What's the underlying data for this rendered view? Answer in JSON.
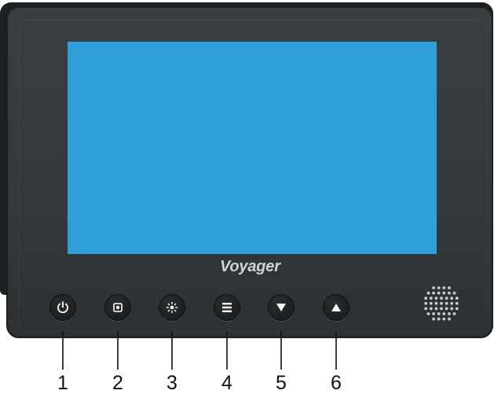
{
  "device": {
    "brand": "Voyager",
    "screen_color": "#2f9fd8",
    "bezel_color": "#383c3e"
  },
  "buttons": [
    {
      "icon": "power-icon",
      "number": "1"
    },
    {
      "icon": "source-icon",
      "number": "2"
    },
    {
      "icon": "brightness-icon",
      "number": "3"
    },
    {
      "icon": "menu-icon",
      "number": "4"
    },
    {
      "icon": "down-arrow-icon",
      "number": "5"
    },
    {
      "icon": "up-arrow-icon",
      "number": "6"
    }
  ],
  "speaker": {
    "icon": "speaker-grille-icon"
  }
}
